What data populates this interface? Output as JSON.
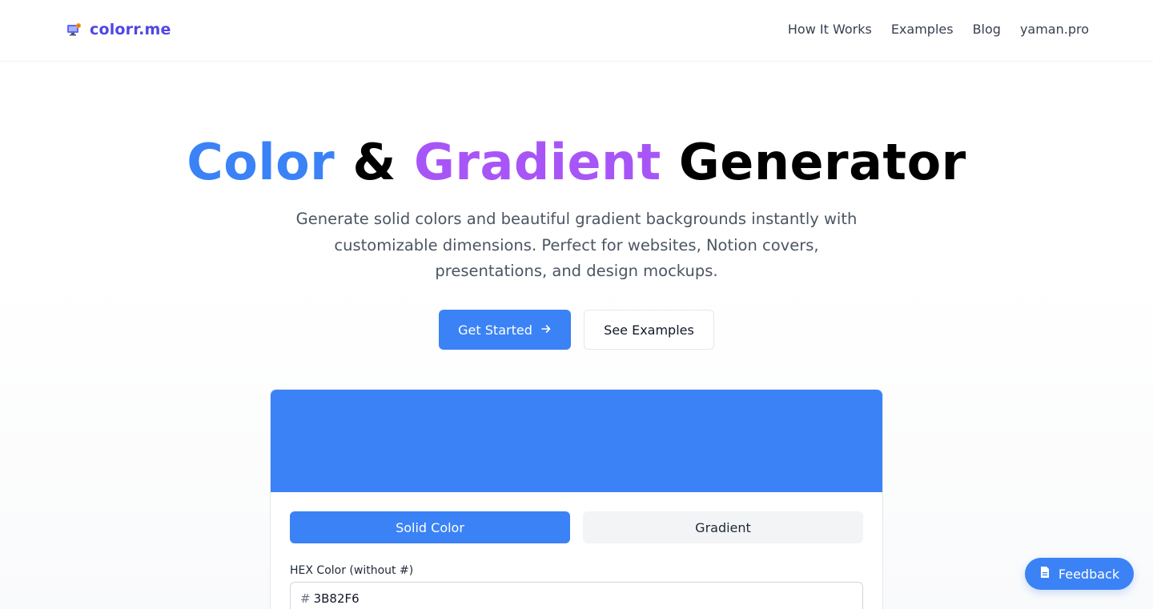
{
  "header": {
    "logo_text": "colorr.me",
    "logo_icon": "monitor-icon",
    "nav": [
      "How It Works",
      "Examples",
      "Blog",
      "yaman.pro"
    ]
  },
  "hero": {
    "title_part1": "Color",
    "title_part2": "&",
    "title_part3": "Gradient",
    "title_part4": "Generator",
    "subtitle": "Generate solid colors and beautiful gradient backgrounds instantly with customizable dimensions. Perfect for websites, Notion covers, presentations, and design mockups.",
    "cta_primary": "Get Started",
    "cta_primary_icon": "arrow-right-icon",
    "cta_secondary": "See Examples"
  },
  "generator": {
    "preview_color": "#3B82F6",
    "tabs": [
      "Solid Color",
      "Gradient"
    ],
    "active_tab": "Solid Color",
    "hex_label": "HEX Color (without #)",
    "hex_prefix": "#",
    "hex_value": "3B82F6"
  },
  "feedback": {
    "label": "Feedback",
    "icon": "document-icon"
  },
  "colors": {
    "brand": "#4F46E5",
    "primary": "#3B82F6",
    "accent_purple": "#A855F7"
  }
}
